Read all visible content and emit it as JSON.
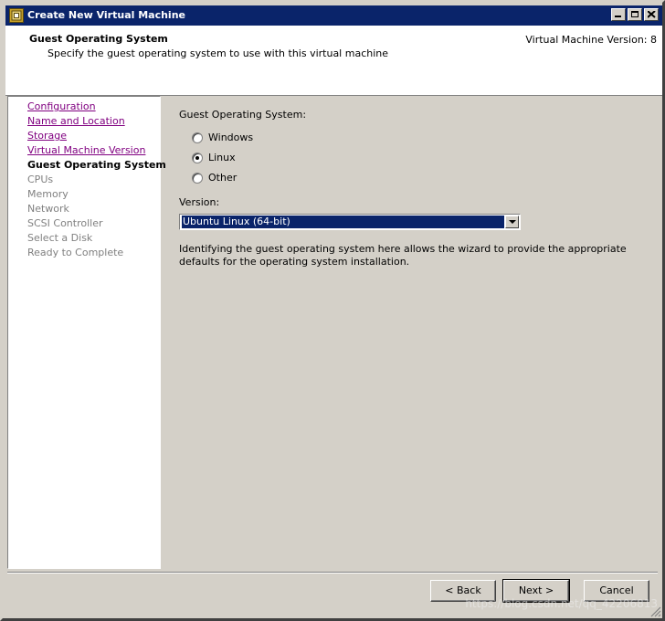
{
  "window": {
    "title": "Create New Virtual Machine"
  },
  "header": {
    "title": "Guest Operating System",
    "subtitle": "Specify the guest operating system to use with this virtual machine",
    "version": "Virtual Machine Version: 8"
  },
  "nav": {
    "items": [
      {
        "label": "Configuration",
        "state": "done"
      },
      {
        "label": "Name and Location",
        "state": "done"
      },
      {
        "label": "Storage",
        "state": "done"
      },
      {
        "label": "Virtual Machine Version",
        "state": "done"
      },
      {
        "label": "Guest Operating System",
        "state": "current"
      },
      {
        "label": "CPUs",
        "state": "future"
      },
      {
        "label": "Memory",
        "state": "future"
      },
      {
        "label": "Network",
        "state": "future"
      },
      {
        "label": "SCSI Controller",
        "state": "future"
      },
      {
        "label": "Select a Disk",
        "state": "future"
      },
      {
        "label": "Ready to Complete",
        "state": "future"
      }
    ]
  },
  "main": {
    "guest_os_label": "Guest Operating System:",
    "os_options": [
      {
        "label": "Windows",
        "checked": false
      },
      {
        "label": "Linux",
        "checked": true
      },
      {
        "label": "Other",
        "checked": false
      }
    ],
    "version_label": "Version:",
    "version_value": "Ubuntu Linux (64-bit)",
    "description": "Identifying the guest operating system here allows the wizard to provide the appropriate defaults for the operating system installation."
  },
  "buttons": {
    "back": "< Back",
    "next": "Next >",
    "cancel": "Cancel"
  },
  "watermark": "https://blog.csdn.net/qq_42206813"
}
